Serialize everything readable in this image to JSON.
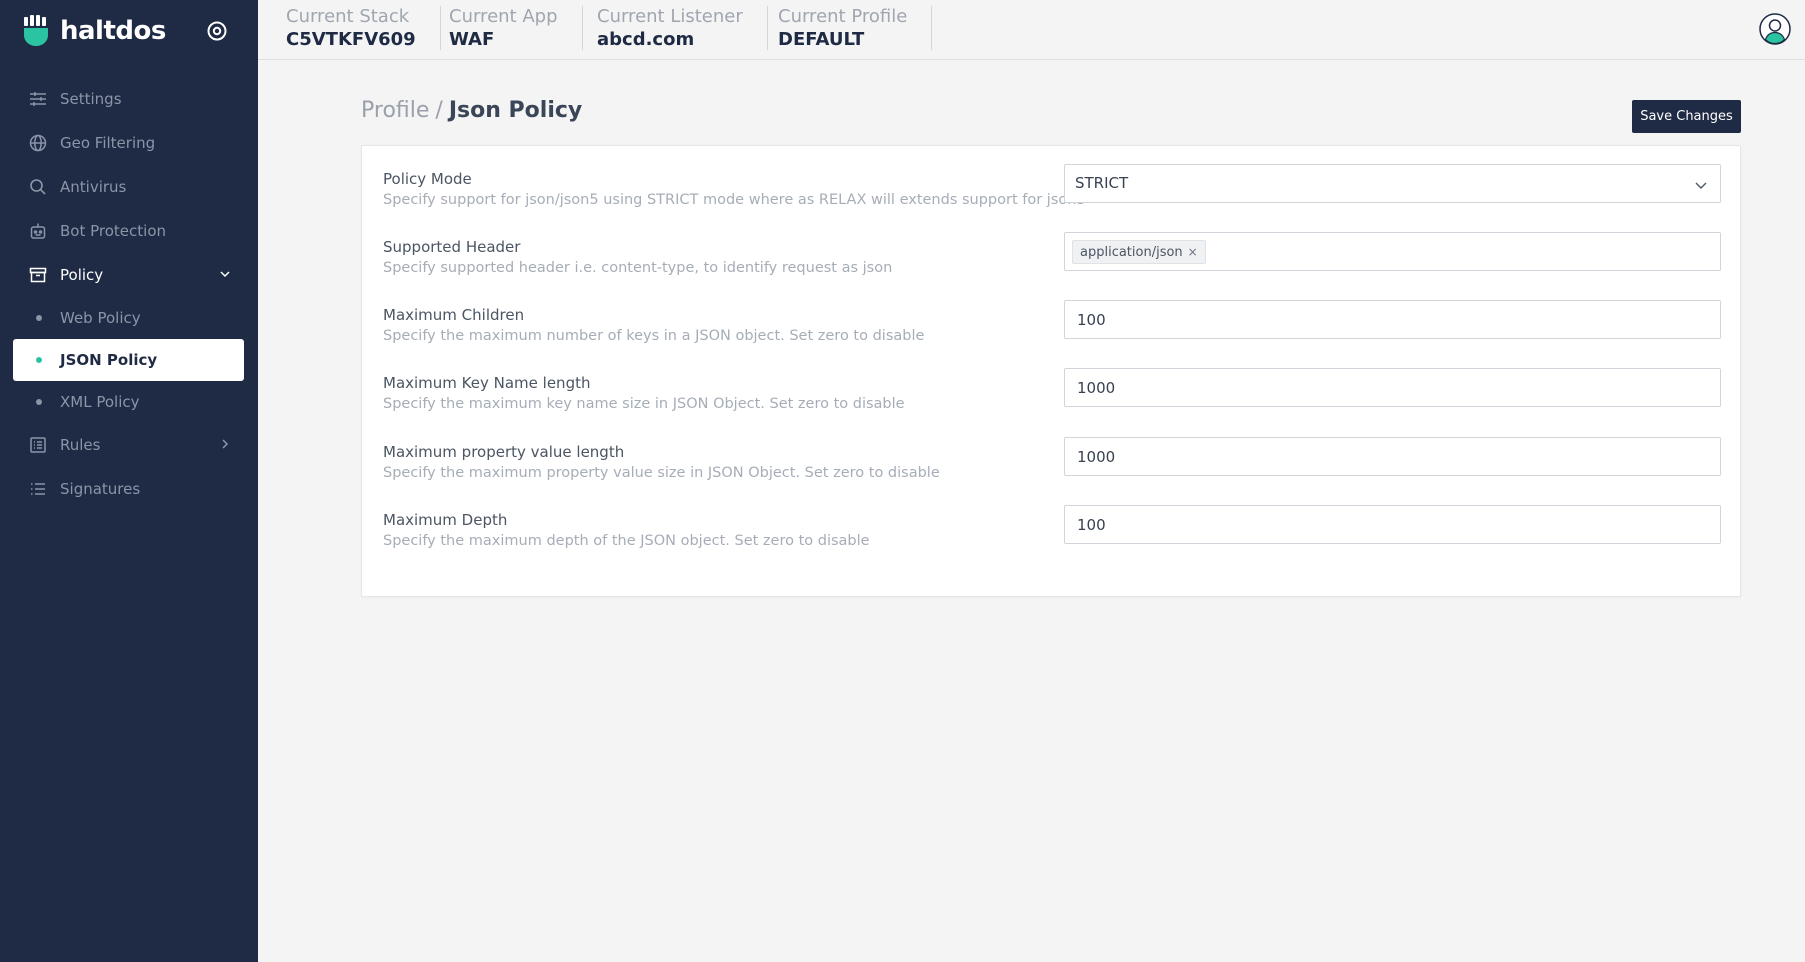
{
  "brand": {
    "name": "haltdos"
  },
  "sidebar": {
    "items": [
      {
        "label": "Settings",
        "icon": "sliders-icon"
      },
      {
        "label": "Geo Filtering",
        "icon": "globe-icon"
      },
      {
        "label": "Antivirus",
        "icon": "search-icon"
      },
      {
        "label": "Bot Protection",
        "icon": "robot-icon"
      },
      {
        "label": "Policy",
        "icon": "archive-icon",
        "expanded": true,
        "children": [
          {
            "label": "Web Policy"
          },
          {
            "label": "JSON Policy",
            "active": true
          },
          {
            "label": "XML Policy"
          }
        ]
      },
      {
        "label": "Rules",
        "icon": "list-box-icon"
      },
      {
        "label": "Signatures",
        "icon": "list-icon"
      }
    ]
  },
  "topbar": {
    "stack": {
      "label": "Current Stack",
      "value": "C5VTKFV609"
    },
    "app": {
      "label": "Current App",
      "value": "WAF"
    },
    "listener": {
      "label": "Current Listener",
      "value": "abcd.com"
    },
    "profile": {
      "label": "Current Profile",
      "value": "DEFAULT"
    }
  },
  "breadcrumb": {
    "parent": "Profile",
    "separator": "/",
    "current": "Json Policy"
  },
  "actions": {
    "save_label": "Save Changes"
  },
  "form": {
    "policy_mode": {
      "label": "Policy Mode",
      "description": "Specify support for json/json5 using STRICT mode where as RELAX will extends support for json5",
      "value": "STRICT"
    },
    "supported_header": {
      "label": "Supported Header",
      "description": "Specify supported header i.e. content-type, to identify request as json",
      "tag": "application/json",
      "tag_remove": "×"
    },
    "max_children": {
      "label": "Maximum Children",
      "description": "Specify the maximum number of keys in a JSON object. Set zero to disable",
      "value": "100"
    },
    "max_key_name_length": {
      "label": "Maximum Key Name length",
      "description": "Specify the maximum key name size in JSON Object. Set zero to disable",
      "value": "1000"
    },
    "max_property_value_length": {
      "label": "Maximum property value length",
      "description": "Specify the maximum property value size in JSON Object. Set zero to disable",
      "value": "1000"
    },
    "max_depth": {
      "label": "Maximum Depth",
      "description": "Specify the maximum depth of the JSON object. Set zero to disable",
      "value": "100"
    }
  },
  "colors": {
    "sidebar_bg": "#1f2a44",
    "accent": "#2bc4a3",
    "button_bg": "#1f2a44"
  }
}
